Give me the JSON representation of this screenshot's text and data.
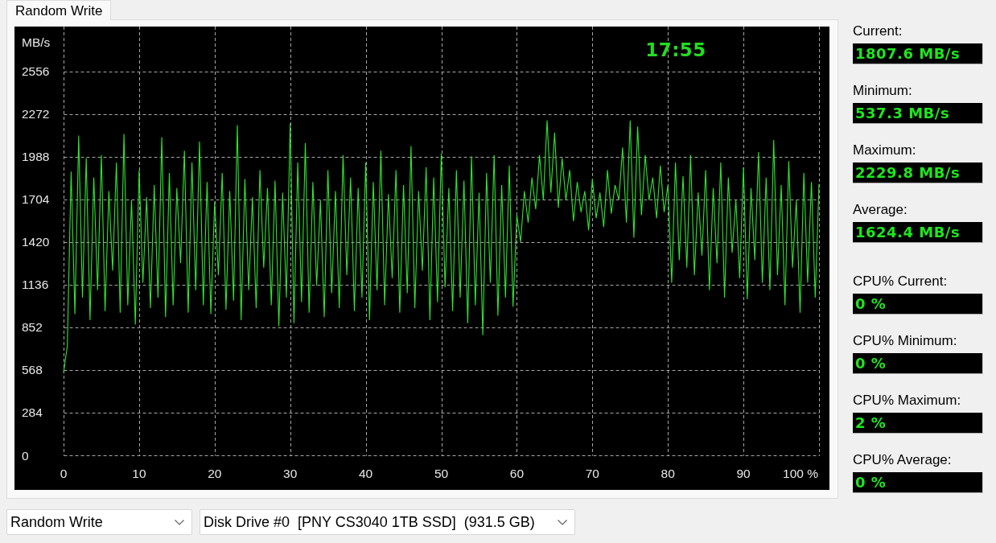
{
  "tabs": [
    {
      "label": "Random Write",
      "selected": true
    }
  ],
  "chart": {
    "timer": "17:55",
    "chart_data": {
      "type": "line",
      "ylabel": "MB/s",
      "grid": true,
      "xlim": [
        0,
        100
      ],
      "ylim": [
        0,
        2856
      ],
      "xticks": [
        0,
        10,
        20,
        30,
        40,
        50,
        60,
        70,
        80,
        90,
        {
          "value": 100,
          "label": "100 %"
        }
      ],
      "yticks": [
        0,
        284,
        568,
        852,
        1136,
        1420,
        1704,
        1988,
        2272,
        2556
      ],
      "x": [
        0,
        0.5,
        1,
        1.5,
        2,
        2.5,
        3,
        3.5,
        4,
        4.5,
        5,
        5.5,
        6,
        6.5,
        7,
        7.5,
        8,
        8.5,
        9,
        9.5,
        10,
        10.5,
        11,
        11.5,
        12,
        12.5,
        13,
        13.5,
        14,
        14.5,
        15,
        15.5,
        16,
        16.5,
        17,
        17.5,
        18,
        18.5,
        19,
        19.5,
        20,
        20.5,
        21,
        21.5,
        22,
        22.5,
        23,
        23.5,
        24,
        24.5,
        25,
        25.5,
        26,
        26.5,
        27,
        27.5,
        28,
        28.5,
        29,
        29.5,
        30,
        30.5,
        31,
        31.5,
        32,
        32.5,
        33,
        33.5,
        34,
        34.5,
        35,
        35.5,
        36,
        36.5,
        37,
        37.5,
        38,
        38.5,
        39,
        39.5,
        40,
        40.5,
        41,
        41.5,
        42,
        42.5,
        43,
        43.5,
        44,
        44.5,
        45,
        45.5,
        46,
        46.5,
        47,
        47.5,
        48,
        48.5,
        49,
        49.5,
        50,
        50.5,
        51,
        51.5,
        52,
        52.5,
        53,
        53.5,
        54,
        54.5,
        55,
        55.5,
        56,
        56.5,
        57,
        57.5,
        58,
        58.5,
        59,
        59.5,
        60,
        60.5,
        61,
        61.5,
        62,
        62.5,
        63,
        63.5,
        64,
        64.5,
        65,
        65.5,
        66,
        66.5,
        67,
        67.5,
        68,
        68.5,
        69,
        69.5,
        70,
        70.5,
        71,
        71.5,
        72,
        72.5,
        73,
        73.5,
        74,
        74.5,
        75,
        75.5,
        76,
        76.5,
        77,
        77.5,
        78,
        78.5,
        79,
        79.5,
        80,
        80.5,
        81,
        81.5,
        82,
        82.5,
        83,
        83.5,
        84,
        84.5,
        85,
        85.5,
        86,
        86.5,
        87,
        87.5,
        88,
        88.5,
        89,
        89.5,
        90,
        90.5,
        91,
        91.5,
        92,
        92.5,
        93,
        93.5,
        94,
        94.5,
        95,
        95.5,
        96,
        96.5,
        97,
        97.5,
        98,
        98.5,
        99,
        99.5,
        100
      ],
      "series": [
        {
          "color": "#2ee62e",
          "values": [
            550,
            730,
            1890,
            940,
            2130,
            1050,
            1980,
            900,
            1850,
            1100,
            2000,
            960,
            1760,
            1230,
            1950,
            950,
            2140,
            1000,
            1700,
            870,
            1900,
            1150,
            1720,
            980,
            1800,
            1050,
            2120,
            920,
            1880,
            1000,
            1780,
            1280,
            2030,
            950,
            1950,
            1100,
            2090,
            1000,
            1820,
            940,
            1690,
            1200,
            1880,
            970,
            1760,
            1030,
            2200,
            900,
            1840,
            1100,
            1720,
            980,
            1900,
            1250,
            1780,
            1000,
            1830,
            860,
            1750,
            1050,
            2210,
            880,
            1950,
            1020,
            2080,
            950,
            1820,
            1130,
            1700,
            920,
            1900,
            1080,
            1760,
            980,
            2000,
            1200,
            1850,
            960,
            1780,
            1050,
            1950,
            900,
            1820,
            1100,
            2030,
            1000,
            1740,
            1180,
            1900,
            950,
            1800,
            1080,
            2060,
            980,
            1760,
            1230,
            1920,
            900,
            1850,
            1020,
            2010,
            1120,
            1780,
            960,
            1900,
            1050,
            1830,
            880,
            1990,
            1000,
            1750,
            800,
            1880,
            1150,
            2000,
            930,
            1800,
            1050,
            1930,
            990,
            1600,
            1420,
            1760,
            1550,
            1850,
            1640,
            2000,
            1700,
            2230,
            1750,
            2150,
            1650,
            1980,
            1700,
            1900,
            1560,
            1820,
            1620,
            1760,
            1500,
            1840,
            1580,
            1750,
            1520,
            1900,
            1610,
            1800,
            1700,
            2050,
            1550,
            2230,
            1450,
            2190,
            1600,
            2000,
            1700,
            1850,
            1580,
            1930,
            1620,
            1800,
            1150,
            1950,
            1300,
            1860,
            1250,
            2000,
            1200,
            1750,
            1330,
            1900,
            1100,
            1780,
            1280,
            1950,
            1050,
            1850,
            1350,
            1700,
            1180,
            1920,
            1040,
            1780,
            1300,
            2020,
            1150,
            1850,
            1100,
            2100,
            1200,
            1800,
            1000,
            1960,
            1250,
            1700,
            950,
            1880,
            1150,
            1820,
            1050,
            1808
          ]
        }
      ]
    }
  },
  "stats": [
    {
      "label": "Current:",
      "value": "1807.6 MB/s"
    },
    {
      "label": "Minimum:",
      "value": "537.3 MB/s"
    },
    {
      "label": "Maximum:",
      "value": "2229.8 MB/s"
    },
    {
      "label": "Average:",
      "value": "1624.4 MB/s"
    }
  ],
  "cpu_stats": [
    {
      "label": "CPU% Current:",
      "value": "0 %"
    },
    {
      "label": "CPU% Minimum:",
      "value": "0 %"
    },
    {
      "label": "CPU% Maximum:",
      "value": "2 %"
    },
    {
      "label": "CPU% Average:",
      "value": "0 %"
    }
  ],
  "test_select": {
    "value": "Random Write"
  },
  "drive_select": {
    "value": "Disk Drive #0  [PNY CS3040 1TB SSD]  (931.5 GB)"
  }
}
